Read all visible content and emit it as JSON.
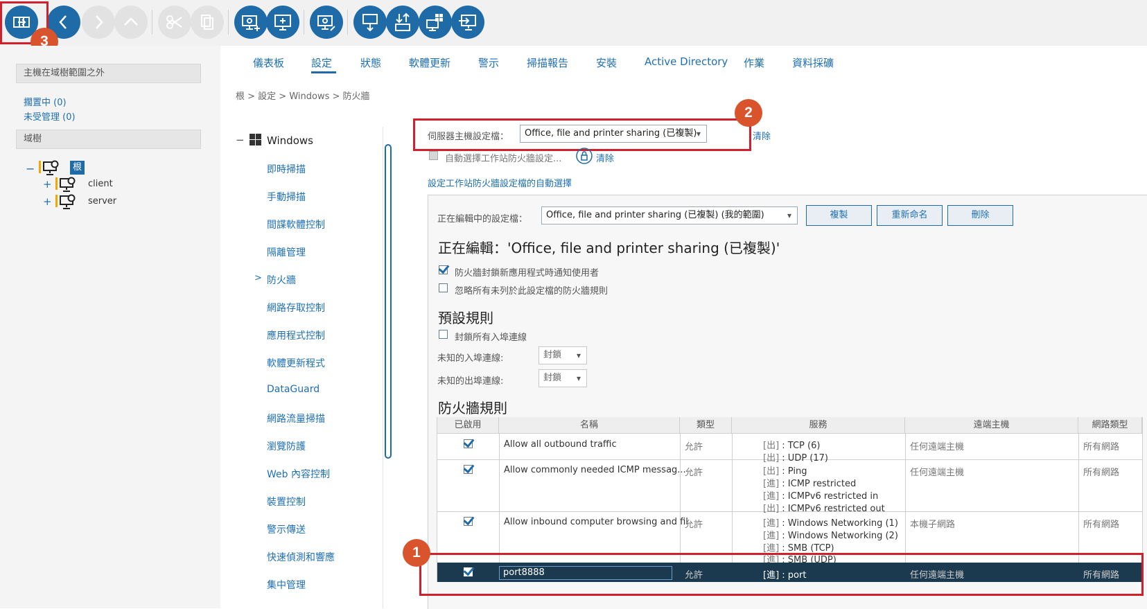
{
  "toolbar": {
    "buttons": [
      {
        "name": "exit-button",
        "icon": "exit-icon",
        "enabled": true
      },
      {
        "name": "back-button",
        "icon": "chevron-left-icon",
        "enabled": true
      },
      {
        "name": "forward-button",
        "icon": "chevron-right-icon",
        "enabled": false
      },
      {
        "name": "up-button",
        "icon": "chevron-up-icon",
        "enabled": false
      },
      {
        "name": "cut-button",
        "icon": "scissors-icon",
        "enabled": false
      },
      {
        "name": "copy-button",
        "icon": "copy-icon",
        "enabled": false
      },
      {
        "name": "add-computer-button",
        "icon": "computer-gear-add-icon",
        "enabled": true
      },
      {
        "name": "add-group-button",
        "icon": "computer-plus-icon",
        "enabled": true
      },
      {
        "name": "computer-settings-button",
        "icon": "computer-gear-edit-icon",
        "enabled": true
      },
      {
        "name": "deploy-button",
        "icon": "download-computer-icon",
        "enabled": true
      },
      {
        "name": "import-export-button",
        "icon": "import-export-icon",
        "enabled": true
      },
      {
        "name": "windows-deploy-button",
        "icon": "windows-computer-icon",
        "enabled": true
      },
      {
        "name": "move-button",
        "icon": "move-computer-icon",
        "enabled": true
      }
    ]
  },
  "markers": {
    "one": "1",
    "two": "2",
    "three": "3"
  },
  "left_panel": {
    "outside_header": "主機在域樹範圍之外",
    "pending": "擱置中 (0)",
    "unmanaged": "未受管理 (0)",
    "domain_tree_header": "域樹",
    "root_label": "根",
    "nodes": [
      "client",
      "server"
    ],
    "expand_symbol": "+",
    "collapse_symbol": "−"
  },
  "tabs": [
    "儀表板",
    "設定",
    "狀態",
    "軟體更新",
    "警示",
    "掃描報告",
    "安裝",
    "Active Directory",
    "作業",
    "資料採礦"
  ],
  "breadcrumb": "根 > 設定 > Windows > 防火牆",
  "nav": {
    "root": "Windows",
    "collapse_symbol": "−",
    "items": [
      "即時掃描",
      "手動掃描",
      "間諜軟體控制",
      "隔離管理",
      "防火牆",
      "網路存取控制",
      "應用程式控制",
      "軟體更新程式",
      "DataGuard",
      "網路流量掃描",
      "瀏覽防護",
      "Web 內容控制",
      "裝置控制",
      "警示傳送",
      "快速偵測和響應",
      "集中管理"
    ],
    "selected_indicator": ">"
  },
  "settings": {
    "server_profile_label": "伺服器主機設定檔：",
    "server_profile_value": "Office, file and printer sharing (已複製)",
    "clear": "清除",
    "auto_select_label": "自動選擇工作站防火牆設定...",
    "auto_select_link": "設定工作站防火牆設定檔的自動選擇",
    "editing_profile_label": "正在編輯中的設定檔：",
    "editing_profile_value": "Office, file and printer sharing (已複製) (我的範圍)",
    "copy_button": "複製",
    "rename_button": "重新命名",
    "delete_button": "刪除",
    "editing_title": "正在編輯：'Office, file and printer sharing (已複製)'",
    "notify_label": "防火牆封鎖新應用程式時通知使用者",
    "ignore_label": "忽略所有未列於此設定檔的防火牆規則",
    "default_rules_title": "預設規則",
    "block_inbound_label": "封鎖所有入埠連線",
    "unknown_inbound_label": "未知的入埠連線:",
    "unknown_inbound_value": "封鎖",
    "unknown_outbound_label": "未知的出埠連線:",
    "unknown_outbound_value": "封鎖",
    "firewall_rules_title": "防火牆規則"
  },
  "rules_table": {
    "columns": [
      "已啟用",
      "名稱",
      "類型",
      "服務",
      "遠端主機",
      "網路類型"
    ],
    "rows": [
      {
        "enabled": true,
        "name": "Allow all outbound traffic",
        "type": "允許",
        "services": [
          [
            "[出]",
            " : TCP (6)"
          ],
          [
            "[出]",
            " : UDP (17)"
          ]
        ],
        "remote": "任何遠端主機",
        "network": "所有網路"
      },
      {
        "enabled": true,
        "name": "Allow commonly needed ICMP messag...",
        "type": "允許",
        "services": [
          [
            "[出]",
            " : Ping"
          ],
          [
            "[進]",
            " : ICMP restricted"
          ],
          [
            "[進]",
            " : ICMPv6 restricted in"
          ],
          [
            "[出]",
            " : ICMPv6 restricted out"
          ]
        ],
        "remote": "任何遠端主機",
        "network": "所有網路"
      },
      {
        "enabled": true,
        "name": "Allow inbound computer browsing and fil",
        "type": "允許",
        "services": [
          [
            "[進]",
            " : Windows Networking (1)"
          ],
          [
            "[進]",
            " : Windows Networking (2)"
          ],
          [
            "[進]",
            " : SMB (TCP)"
          ],
          [
            "[進]",
            " : SMB (UDP)"
          ]
        ],
        "remote": "本機子網路",
        "network": "所有網路"
      },
      {
        "enabled": true,
        "name": "port8888",
        "type": "允許",
        "services": [
          [
            "[進]",
            " : port"
          ]
        ],
        "remote": "任何遠端主機",
        "network": "所有網路",
        "selected": true
      }
    ]
  },
  "colors": {
    "accent": "#1e6ba8",
    "marker": "#d9532c",
    "highlight": "#d0202c",
    "selected_row": "#1b3a4f"
  }
}
